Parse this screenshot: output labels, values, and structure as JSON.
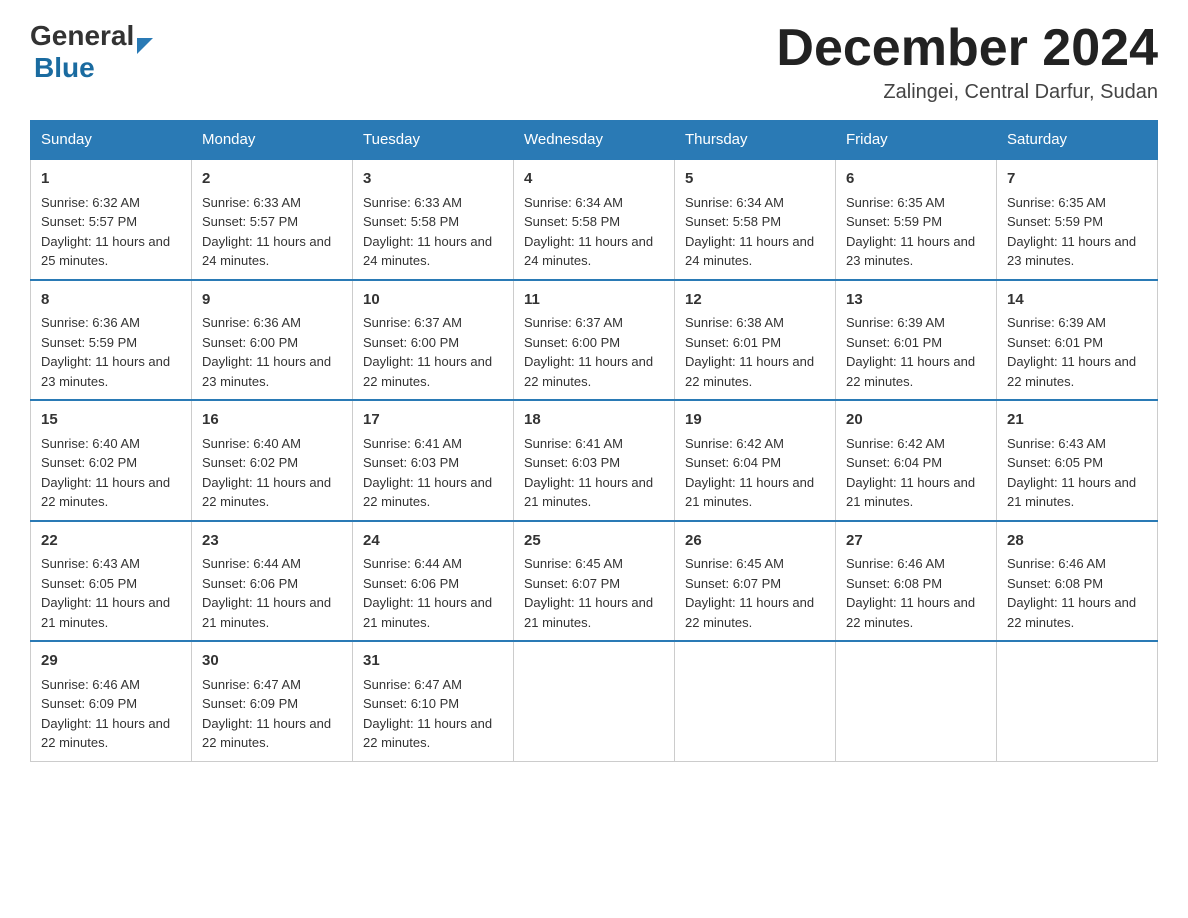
{
  "logo": {
    "text_general": "General",
    "text_blue": "Blue",
    "arrow_color": "#1a6ba0"
  },
  "header": {
    "month_title": "December 2024",
    "location": "Zalingei, Central Darfur, Sudan"
  },
  "days_of_week": [
    "Sunday",
    "Monday",
    "Tuesday",
    "Wednesday",
    "Thursday",
    "Friday",
    "Saturday"
  ],
  "weeks": [
    [
      {
        "day": "1",
        "sunrise": "6:32 AM",
        "sunset": "5:57 PM",
        "daylight": "11 hours and 25 minutes."
      },
      {
        "day": "2",
        "sunrise": "6:33 AM",
        "sunset": "5:57 PM",
        "daylight": "11 hours and 24 minutes."
      },
      {
        "day": "3",
        "sunrise": "6:33 AM",
        "sunset": "5:58 PM",
        "daylight": "11 hours and 24 minutes."
      },
      {
        "day": "4",
        "sunrise": "6:34 AM",
        "sunset": "5:58 PM",
        "daylight": "11 hours and 24 minutes."
      },
      {
        "day": "5",
        "sunrise": "6:34 AM",
        "sunset": "5:58 PM",
        "daylight": "11 hours and 24 minutes."
      },
      {
        "day": "6",
        "sunrise": "6:35 AM",
        "sunset": "5:59 PM",
        "daylight": "11 hours and 23 minutes."
      },
      {
        "day": "7",
        "sunrise": "6:35 AM",
        "sunset": "5:59 PM",
        "daylight": "11 hours and 23 minutes."
      }
    ],
    [
      {
        "day": "8",
        "sunrise": "6:36 AM",
        "sunset": "5:59 PM",
        "daylight": "11 hours and 23 minutes."
      },
      {
        "day": "9",
        "sunrise": "6:36 AM",
        "sunset": "6:00 PM",
        "daylight": "11 hours and 23 minutes."
      },
      {
        "day": "10",
        "sunrise": "6:37 AM",
        "sunset": "6:00 PM",
        "daylight": "11 hours and 22 minutes."
      },
      {
        "day": "11",
        "sunrise": "6:37 AM",
        "sunset": "6:00 PM",
        "daylight": "11 hours and 22 minutes."
      },
      {
        "day": "12",
        "sunrise": "6:38 AM",
        "sunset": "6:01 PM",
        "daylight": "11 hours and 22 minutes."
      },
      {
        "day": "13",
        "sunrise": "6:39 AM",
        "sunset": "6:01 PM",
        "daylight": "11 hours and 22 minutes."
      },
      {
        "day": "14",
        "sunrise": "6:39 AM",
        "sunset": "6:01 PM",
        "daylight": "11 hours and 22 minutes."
      }
    ],
    [
      {
        "day": "15",
        "sunrise": "6:40 AM",
        "sunset": "6:02 PM",
        "daylight": "11 hours and 22 minutes."
      },
      {
        "day": "16",
        "sunrise": "6:40 AM",
        "sunset": "6:02 PM",
        "daylight": "11 hours and 22 minutes."
      },
      {
        "day": "17",
        "sunrise": "6:41 AM",
        "sunset": "6:03 PM",
        "daylight": "11 hours and 22 minutes."
      },
      {
        "day": "18",
        "sunrise": "6:41 AM",
        "sunset": "6:03 PM",
        "daylight": "11 hours and 21 minutes."
      },
      {
        "day": "19",
        "sunrise": "6:42 AM",
        "sunset": "6:04 PM",
        "daylight": "11 hours and 21 minutes."
      },
      {
        "day": "20",
        "sunrise": "6:42 AM",
        "sunset": "6:04 PM",
        "daylight": "11 hours and 21 minutes."
      },
      {
        "day": "21",
        "sunrise": "6:43 AM",
        "sunset": "6:05 PM",
        "daylight": "11 hours and 21 minutes."
      }
    ],
    [
      {
        "day": "22",
        "sunrise": "6:43 AM",
        "sunset": "6:05 PM",
        "daylight": "11 hours and 21 minutes."
      },
      {
        "day": "23",
        "sunrise": "6:44 AM",
        "sunset": "6:06 PM",
        "daylight": "11 hours and 21 minutes."
      },
      {
        "day": "24",
        "sunrise": "6:44 AM",
        "sunset": "6:06 PM",
        "daylight": "11 hours and 21 minutes."
      },
      {
        "day": "25",
        "sunrise": "6:45 AM",
        "sunset": "6:07 PM",
        "daylight": "11 hours and 21 minutes."
      },
      {
        "day": "26",
        "sunrise": "6:45 AM",
        "sunset": "6:07 PM",
        "daylight": "11 hours and 22 minutes."
      },
      {
        "day": "27",
        "sunrise": "6:46 AM",
        "sunset": "6:08 PM",
        "daylight": "11 hours and 22 minutes."
      },
      {
        "day": "28",
        "sunrise": "6:46 AM",
        "sunset": "6:08 PM",
        "daylight": "11 hours and 22 minutes."
      }
    ],
    [
      {
        "day": "29",
        "sunrise": "6:46 AM",
        "sunset": "6:09 PM",
        "daylight": "11 hours and 22 minutes."
      },
      {
        "day": "30",
        "sunrise": "6:47 AM",
        "sunset": "6:09 PM",
        "daylight": "11 hours and 22 minutes."
      },
      {
        "day": "31",
        "sunrise": "6:47 AM",
        "sunset": "6:10 PM",
        "daylight": "11 hours and 22 minutes."
      },
      {
        "day": "",
        "sunrise": "",
        "sunset": "",
        "daylight": ""
      },
      {
        "day": "",
        "sunrise": "",
        "sunset": "",
        "daylight": ""
      },
      {
        "day": "",
        "sunrise": "",
        "sunset": "",
        "daylight": ""
      },
      {
        "day": "",
        "sunrise": "",
        "sunset": "",
        "daylight": ""
      }
    ]
  ],
  "labels": {
    "sunrise_prefix": "Sunrise: ",
    "sunset_prefix": "Sunset: ",
    "daylight_prefix": "Daylight: "
  }
}
